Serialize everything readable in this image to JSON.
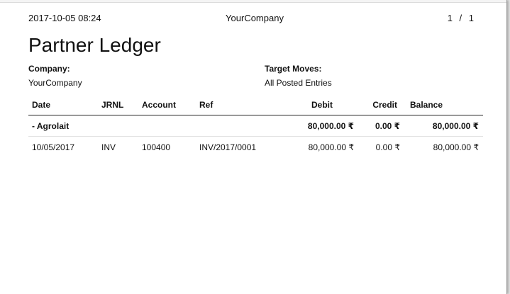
{
  "header": {
    "datetime": "2017-10-05 08:24",
    "company": "YourCompany",
    "pager": "1 / 1"
  },
  "report": {
    "title": "Partner Ledger",
    "company_label": "Company:",
    "company_value": "YourCompany",
    "moves_label": "Target Moves:",
    "moves_value": "All Posted Entries"
  },
  "table": {
    "columns": [
      "Date",
      "JRNL",
      "Account",
      "Ref",
      "Debit",
      "Credit",
      "Balance"
    ],
    "groups": [
      {
        "partner": "- Agrolait",
        "debit": "80,000.00 ₹",
        "credit": "0.00 ₹",
        "balance": "80,000.00 ₹",
        "lines": [
          {
            "date": "10/05/2017",
            "jrnl": "INV",
            "account": "100400",
            "ref": "INV/2017/0001",
            "debit": "80,000.00 ₹",
            "credit": "0.00 ₹",
            "balance": "80,000.00 ₹"
          }
        ]
      }
    ]
  }
}
